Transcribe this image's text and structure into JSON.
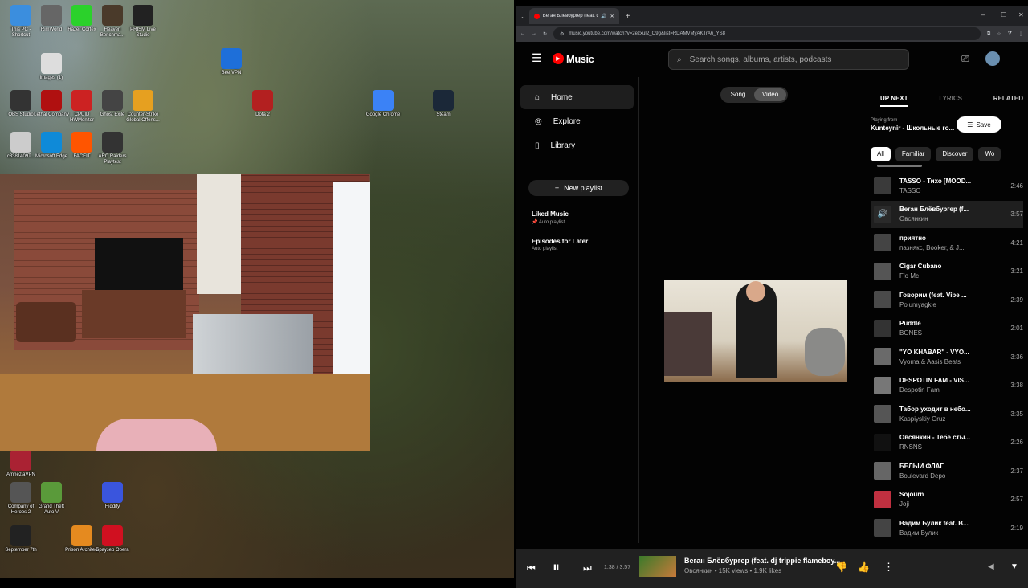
{
  "desktop": {
    "icons": [
      {
        "label": "This PC - Shortcut",
        "color": "#3b8ede"
      },
      {
        "label": "RimWorld",
        "color": "#666"
      },
      {
        "label": "Razer Cortex",
        "color": "#2bd12b"
      },
      {
        "label": "Heaven Benchma...",
        "color": "#4a3a2a"
      },
      {
        "label": "PRISM Live Studio",
        "color": "#222"
      },
      {
        "label": "images (1)",
        "color": "#ddd"
      },
      {
        "label": "Bee VPN",
        "color": "#1e6fd9"
      },
      {
        "label": "OBS Studio",
        "color": "#333"
      },
      {
        "label": "Lethal Company",
        "color": "#b01010"
      },
      {
        "label": "CPUID HWMonitor",
        "color": "#c22"
      },
      {
        "label": "Ghost Exile",
        "color": "#444"
      },
      {
        "label": "Counter-Strike Global Offens...",
        "color": "#e6a020"
      },
      {
        "label": "Dota 2",
        "color": "#b32020"
      },
      {
        "label": "Google Chrome",
        "color": "#3b82f6"
      },
      {
        "label": "Steam",
        "color": "#1b2838"
      },
      {
        "label": "c3381409T...",
        "color": "#ccc"
      },
      {
        "label": "Microsoft Edge",
        "color": "#0f8ad8"
      },
      {
        "label": "FACEIT",
        "color": "#ff5500"
      },
      {
        "label": "ARC Raiders Playtest",
        "color": "#333"
      },
      {
        "label": "AmneziaVPN",
        "color": "#a23"
      },
      {
        "label": "Company of Heroes 2",
        "color": "#555"
      },
      {
        "label": "Grand Theft Auto V",
        "color": "#5a9a3a"
      },
      {
        "label": "Hiddify",
        "color": "#3a55dd"
      },
      {
        "label": "September 7th",
        "color": "#222"
      },
      {
        "label": "Prison Architect",
        "color": "#e58a1f"
      },
      {
        "label": "Браузер Opera",
        "color": "#d01020"
      }
    ]
  },
  "browser": {
    "tab_title": "Веган Блёвбургер (feat. dj",
    "url": "music.youtube.com/watch?v=2ezxuI2_O9g&list=RDAMVMyAKTrA6_YS8"
  },
  "ytmusic": {
    "logo": "Music",
    "search_placeholder": "Search songs, albums, artists, podcasts",
    "nav": [
      "Home",
      "Explore",
      "Library"
    ],
    "new_playlist": "New playlist",
    "playlists": [
      {
        "name": "Liked Music",
        "sub": "Auto playlist"
      },
      {
        "name": "Episodes for Later",
        "sub": "Auto playlist"
      }
    ],
    "toggle": {
      "song": "Song",
      "video": "Video"
    },
    "queue_tabs": [
      "UP NEXT",
      "LYRICS",
      "RELATED"
    ],
    "playing_from_label": "Playing from",
    "playing_from": "Kunteynir - Школьные го...",
    "save": "Save",
    "chips": [
      "All",
      "Familiar",
      "Discover",
      "Wo"
    ],
    "queue": [
      {
        "title": "TASSO - Тихо [MOOD...",
        "artist": "TASSO",
        "duration": "2:46"
      },
      {
        "title": "Веган Блёвбургер (f...",
        "artist": "Овсянкин",
        "duration": "3:57"
      },
      {
        "title": "приятно",
        "artist": "пазнякс, Booker, & J...",
        "duration": "4:21"
      },
      {
        "title": "Cigar Cubano",
        "artist": "Flo Mc",
        "duration": "3:21"
      },
      {
        "title": "Говорим (feat. Vibe ...",
        "artist": "Polumyagkie",
        "duration": "2:39"
      },
      {
        "title": "Puddle",
        "artist": "BONES",
        "duration": "2:01"
      },
      {
        "title": "\"YO KHABAR\" - VYO...",
        "artist": "Vyoma & Aasis Beats",
        "duration": "3:36"
      },
      {
        "title": "DESPOTIN FAM - VIS...",
        "artist": "Despotin Fam",
        "duration": "3:38"
      },
      {
        "title": "Табор уходит в небо...",
        "artist": "Kaspiyskiy Gruz",
        "duration": "3:35"
      },
      {
        "title": "Овсянкин - Тебе сты...",
        "artist": "RNSNS",
        "duration": "2:26"
      },
      {
        "title": "БЕЛЫЙ ФЛАГ",
        "artist": "Boulevard Depo",
        "duration": "2:37"
      },
      {
        "title": "Sojourn",
        "artist": "Joji",
        "duration": "2:57"
      },
      {
        "title": "Вадим Булик feat. В...",
        "artist": "Вадим Булик",
        "duration": "2:19"
      }
    ],
    "player": {
      "time": "1:38 / 3:57",
      "progress": 0.41,
      "title": "Веган Блёвбургер (feat. dj trippie flameboy...",
      "meta": "Овсянкин • 15K views • 1.9K likes"
    }
  }
}
